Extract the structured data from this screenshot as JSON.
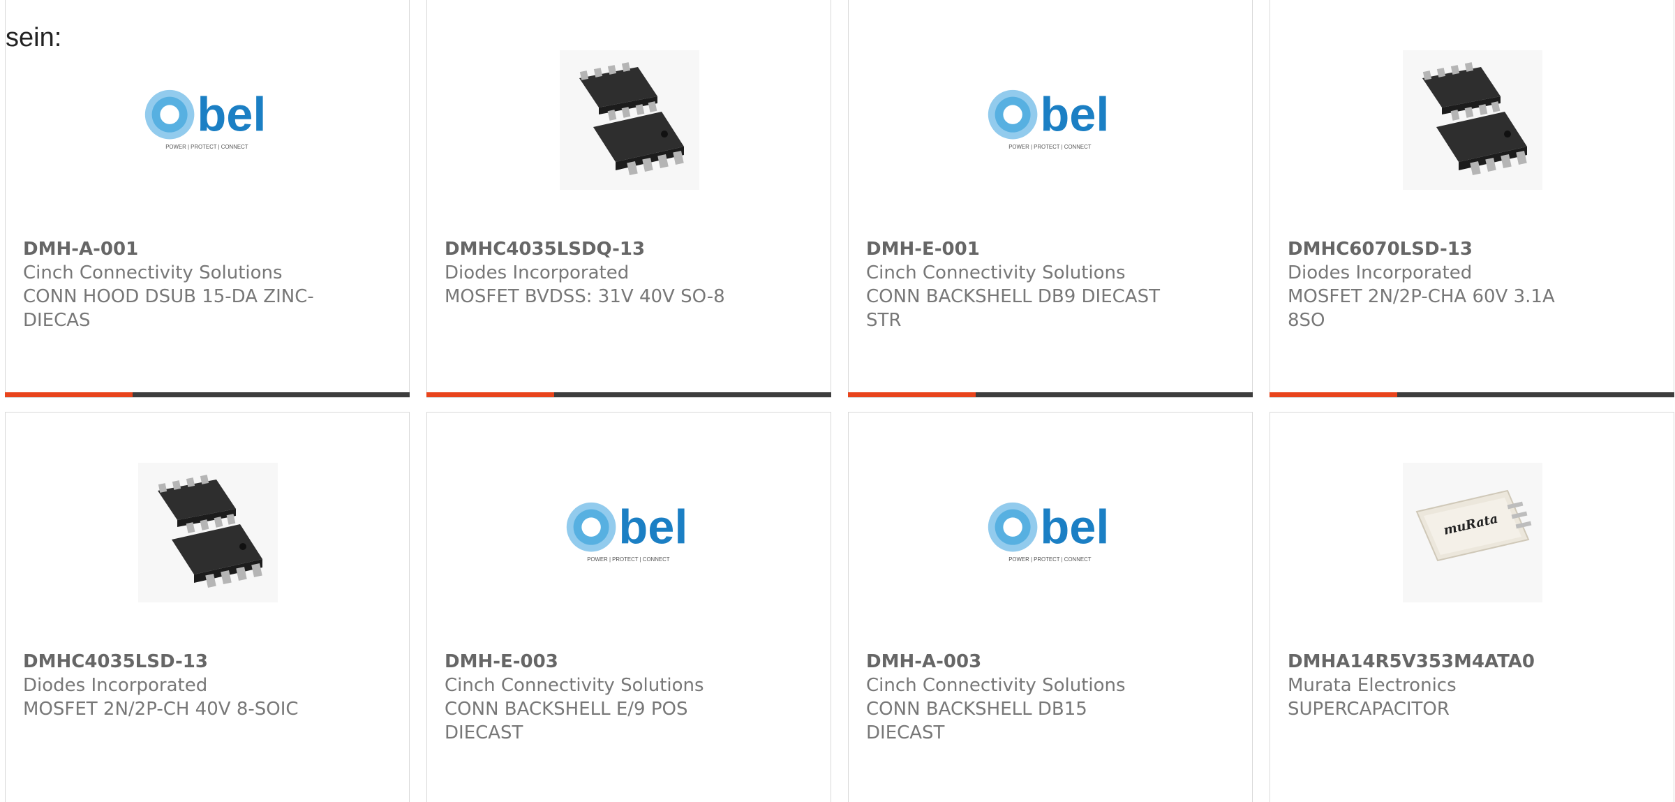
{
  "heading": "sein:",
  "colors": {
    "accent": "#e8441c",
    "bar": "#3d3d3d",
    "bel_blue": "#1b8fd2"
  },
  "products": [
    {
      "part_number": "DMH-A-001",
      "manufacturer": "Cinch Connectivity Solutions",
      "description": "CONN HOOD DSUB 15-DA ZINC-DIECAS",
      "image": "bel-logo",
      "logo_text": "bel",
      "logo_tagline": "POWER | PROTECT | CONNECT"
    },
    {
      "part_number": "DMHC4035LSDQ-13",
      "manufacturer": "Diodes Incorporated",
      "description": "MOSFET BVDSS: 31V 40V SO-8",
      "image": "so8-chip"
    },
    {
      "part_number": "DMH-E-001",
      "manufacturer": "Cinch Connectivity Solutions",
      "description": "CONN BACKSHELL DB9 DIECAST STR",
      "image": "bel-logo",
      "logo_text": "bel",
      "logo_tagline": "POWER | PROTECT | CONNECT"
    },
    {
      "part_number": "DMHC6070LSD-13",
      "manufacturer": "Diodes Incorporated",
      "description": "MOSFET 2N/2P-CHA 60V 3.1A 8SO",
      "image": "so8-chip"
    },
    {
      "part_number": "DMHC4035LSD-13",
      "manufacturer": "Diodes Incorporated",
      "description": "MOSFET 2N/2P-CH 40V 8-SOIC",
      "image": "so8-chip"
    },
    {
      "part_number": "DMH-E-003",
      "manufacturer": "Cinch Connectivity Solutions",
      "description": "CONN BACKSHELL E/9 POS DIECAST",
      "image": "bel-logo",
      "logo_text": "bel",
      "logo_tagline": "POWER | PROTECT | CONNECT"
    },
    {
      "part_number": "DMH-A-003",
      "manufacturer": "Cinch Connectivity Solutions",
      "description": "CONN BACKSHELL DB15 DIECAST",
      "image": "bel-logo",
      "logo_text": "bel",
      "logo_tagline": "POWER | PROTECT | CONNECT"
    },
    {
      "part_number": "DMHA14R5V353M4ATA0",
      "manufacturer": "Murata Electronics",
      "description": "SUPERCAPACITOR",
      "image": "murata-supercap",
      "logo_text": "muRata"
    }
  ]
}
